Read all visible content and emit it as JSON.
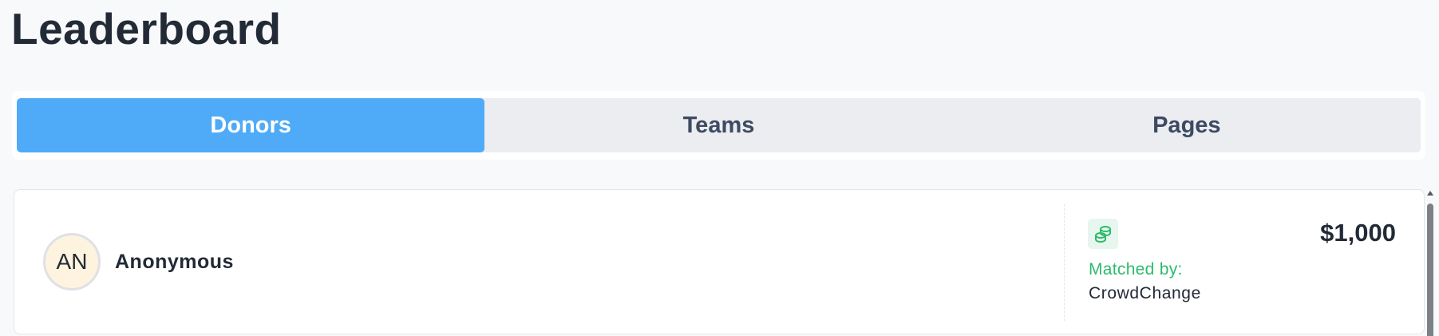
{
  "page": {
    "title": "Leaderboard"
  },
  "tabs": [
    {
      "label": "Donors",
      "active": true
    },
    {
      "label": "Teams",
      "active": false
    },
    {
      "label": "Pages",
      "active": false
    }
  ],
  "leaderboard": {
    "entries": [
      {
        "initials": "AN",
        "name": "Anonymous",
        "icon": "coins-icon",
        "matched_label": "Matched by:",
        "matched_by": "CrowdChange",
        "amount": "$1,000"
      }
    ]
  },
  "colors": {
    "accent": "#4fabf8",
    "matched": "#2dbb6d",
    "avatar_bg": "#fdf3df"
  }
}
